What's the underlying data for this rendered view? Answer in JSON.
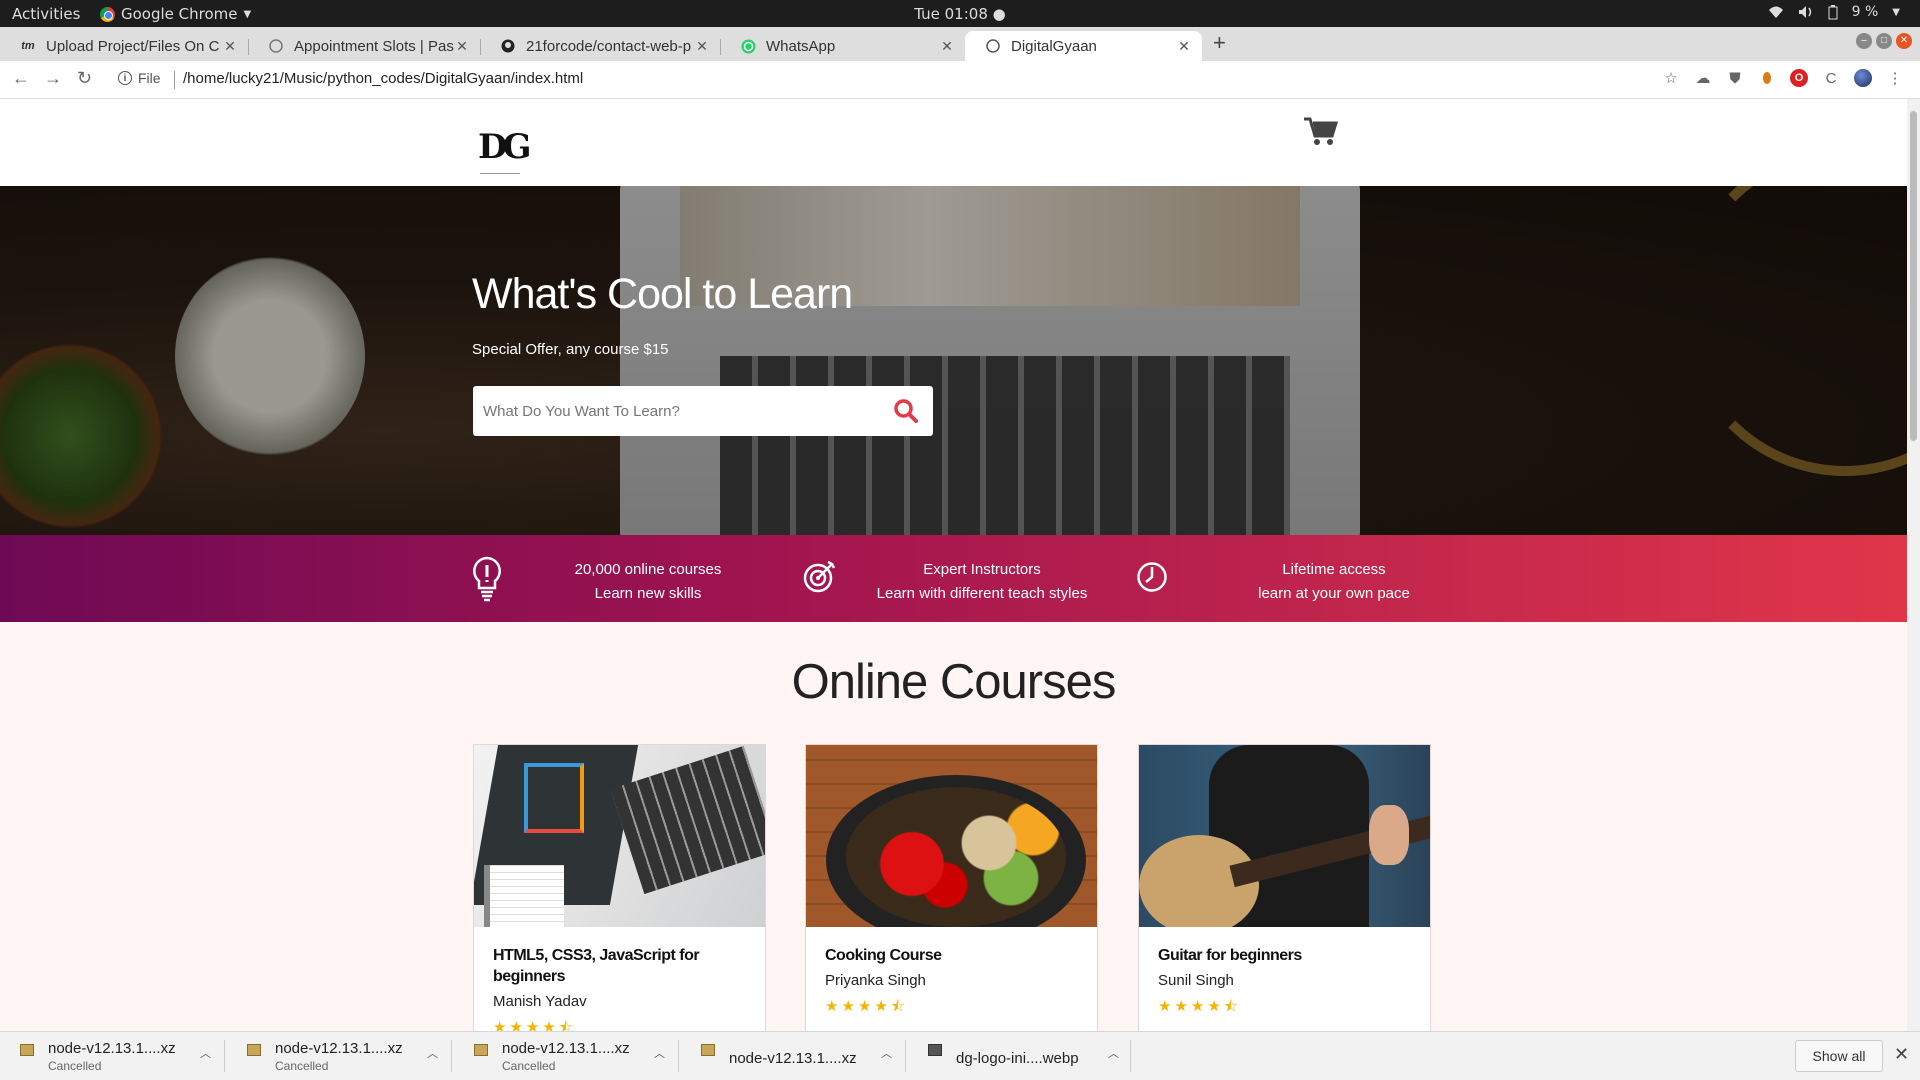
{
  "os": {
    "activities": "Activities",
    "app_name": "Google Chrome",
    "clock": "Tue 01:08",
    "battery": "9 %"
  },
  "browser": {
    "tabs": [
      {
        "label": "Upload Project/Files On C",
        "icon": "tm-icon"
      },
      {
        "label": "Appointment Slots | Pass",
        "icon": "globe-icon"
      },
      {
        "label": "21forcode/contact-web-p",
        "icon": "github-icon"
      },
      {
        "label": "WhatsApp",
        "icon": "whatsapp-icon"
      },
      {
        "label": "DigitalGyaan",
        "icon": "globe-icon",
        "active": true
      }
    ],
    "scheme_label": "File",
    "url": "/home/lucky21/Music/python_codes/DigitalGyaan/index.html"
  },
  "site": {
    "logo": "DG",
    "hero": {
      "title": "What's Cool to Learn",
      "subtitle": "Special Offer, any course $15",
      "search_placeholder": "What Do You Want To Learn?"
    },
    "features": [
      {
        "line1": "20,000 online courses",
        "line2": "Learn new skills",
        "icon": "lightbulb-icon"
      },
      {
        "line1": "Expert Instructors",
        "line2": "Learn with different teach styles",
        "icon": "target-icon"
      },
      {
        "line1": "Lifetime access",
        "line2": "learn at your own pace",
        "icon": "clock-icon"
      }
    ],
    "courses_title": "Online Courses",
    "courses": [
      {
        "title": "HTML5, CSS3, JavaScript for beginners",
        "author": "Manish Yadav",
        "rating": 4.5
      },
      {
        "title": "Cooking Course",
        "author": "Priyanka Singh",
        "rating": 4.5
      },
      {
        "title": "Guitar for beginners",
        "author": "Sunil Singh",
        "rating": 4.5
      }
    ],
    "star_text": "★★★★⯪",
    "brand_color": "#e63946"
  },
  "downloads": {
    "items": [
      {
        "name": "node-v12.13.1....xz",
        "status": "Cancelled"
      },
      {
        "name": "node-v12.13.1....xz",
        "status": "Cancelled"
      },
      {
        "name": "node-v12.13.1....xz",
        "status": "Cancelled"
      },
      {
        "name": "node-v12.13.1....xz",
        "status": ""
      },
      {
        "name": "dg-logo-ini....webp",
        "status": ""
      }
    ],
    "show_all": "Show all"
  }
}
